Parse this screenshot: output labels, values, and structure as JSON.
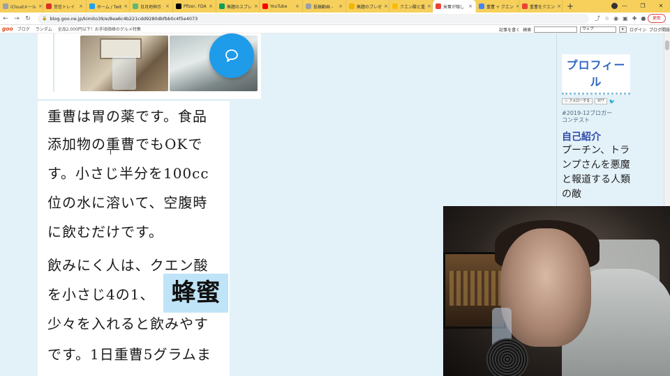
{
  "browser": {
    "tabs": [
      {
        "label": "iCloudメール",
        "color": "#9aa0a6"
      },
      {
        "label": "受信トレイ",
        "color": "#d93025"
      },
      {
        "label": "ホーム / Twit",
        "color": "#1da1f2"
      },
      {
        "label": "日月地神示",
        "color": "#5bb974"
      },
      {
        "label": "Pfizer, FDA",
        "color": "#000000"
      },
      {
        "label": "無題のスプレ",
        "color": "#0f9d58"
      },
      {
        "label": "YouTube",
        "color": "#ff0000"
      },
      {
        "label": "投稿動画 -",
        "color": "#9aa0a6"
      },
      {
        "label": "無題のプレゼ",
        "color": "#f4b400"
      },
      {
        "label": "クエン酸と重",
        "color": "#fbbc04"
      },
      {
        "label": "米軍が隠し",
        "color": "#ea4335",
        "active": true
      },
      {
        "label": "重曹 + クエン",
        "color": "#4285f4"
      },
      {
        "label": "重曹をクエン",
        "color": "#ea4335"
      }
    ],
    "url": "blog.goo.ne.jp/kimito39/e/8ea6c4b221cdd9280dbfbb0c4f5e4073",
    "update_label": "更新"
  },
  "goo_bar": {
    "logo": "goo",
    "links": [
      "ブログ",
      "ランダム",
      "全品2,000円以下！お手頃価格のグルメ特集"
    ],
    "write_label": "記事を書く",
    "search_label": "検索",
    "select_value": "ウェブ",
    "login_label": "ログイン",
    "open_label": "ブログ開設"
  },
  "article": {
    "lines": [
      "重曹は胃の薬です。食品",
      "添加物の重曹でもOKで",
      "す。小さじ半分を100cc",
      "位の水に溶いて、空腹時",
      "に飲むだけです。",
      "飲みにく人は、クエン酸",
      "を小さじ4の1、",
      "少々を入れると飲みやす",
      "です。1日重曹5グラムま"
    ],
    "highlight": "蜂蜜"
  },
  "sidebar": {
    "profile_title": "プロフィール",
    "follow_label": "フォローする",
    "follow_count": "977",
    "tag": "#2019-12ブロガーコンテスト",
    "intro_heading": "自己紹介",
    "intro_body": "プーチン、トランプさんを悪魔と報道する人類の敵"
  },
  "colors": {
    "tabbar": "#f6d05b",
    "comment_button": "#1e9be9",
    "highlight_bg": "#bfe3f7",
    "profile_title": "#2f67c0",
    "intro_heading": "#2f4aa8"
  }
}
